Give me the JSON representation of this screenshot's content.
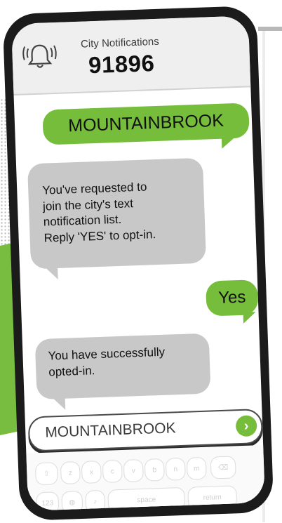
{
  "header": {
    "icon": "bell-icon",
    "title": "City Notifications",
    "number": "91896"
  },
  "messages": [
    {
      "from": "user",
      "text": "MOUNTAINBROOK"
    },
    {
      "from": "city",
      "lines": [
        "You've requested to",
        "join the city's text",
        "notification list.",
        "Reply 'YES' to opt-in."
      ]
    },
    {
      "from": "user",
      "text": "Yes"
    },
    {
      "from": "city",
      "lines": [
        "You have successfully",
        "opted-in."
      ]
    }
  ],
  "input": {
    "value": "MOUNTAINBROOK",
    "send_icon": "send-arrow-icon"
  },
  "keyboard": {
    "row3": [
      "z",
      "x",
      "c",
      "v",
      "b",
      "n",
      "m"
    ],
    "numbers_key": "123",
    "space_key": "space",
    "return_key": "return",
    "shift_icon": "shift-icon",
    "backspace_icon": "backspace-icon",
    "globe_icon": "globe-icon",
    "mic_icon": "microphone-icon"
  },
  "colors": {
    "accent_green": "#76bd3b",
    "bubble_gray": "#c8c8c8",
    "phone_frame": "#1b1b1b"
  }
}
